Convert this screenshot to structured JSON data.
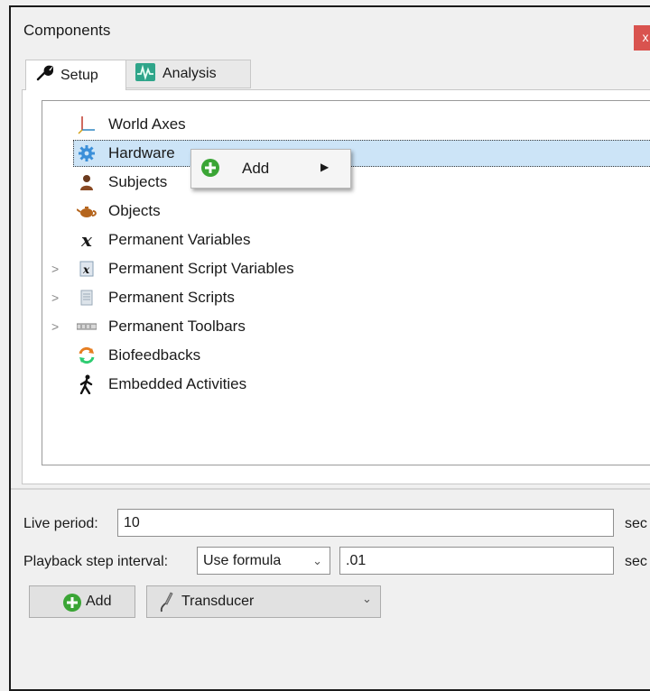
{
  "window": {
    "title": "Components",
    "close_label": "x"
  },
  "tabs": [
    {
      "label": "Setup",
      "icon": "wrench-icon",
      "active": true
    },
    {
      "label": "Analysis",
      "icon": "analysis-wave-icon",
      "active": false
    }
  ],
  "tree": {
    "items": [
      {
        "label": "World Axes",
        "icon": "axes-icon",
        "expandable": false
      },
      {
        "label": "Hardware",
        "icon": "gear-icon",
        "expandable": false,
        "selected": true
      },
      {
        "label": "Subjects",
        "icon": "person-icon",
        "expandable": false
      },
      {
        "label": "Objects",
        "icon": "teapot-icon",
        "expandable": false
      },
      {
        "label": "Permanent Variables",
        "icon": "variable-x-icon",
        "expandable": false
      },
      {
        "label": "Permanent Script Variables",
        "icon": "script-variable-icon",
        "expandable": true
      },
      {
        "label": "Permanent Scripts",
        "icon": "script-icon",
        "expandable": true
      },
      {
        "label": "Permanent Toolbars",
        "icon": "toolbar-icon",
        "expandable": true
      },
      {
        "label": "Biofeedbacks",
        "icon": "biofeedback-icon",
        "expandable": false
      },
      {
        "label": "Embedded Activities",
        "icon": "walking-icon",
        "expandable": false
      }
    ]
  },
  "context_menu": {
    "items": [
      {
        "label": "Add",
        "icon": "add-circle-icon",
        "has_submenu": true
      }
    ]
  },
  "settings": {
    "live_period_label": "Live period:",
    "live_period_value": "10",
    "live_period_unit": "sec",
    "playback_label": "Playback step interval:",
    "playback_mode": "Use formula",
    "playback_value": ".01",
    "playback_unit": "sec"
  },
  "bottom": {
    "add_label": "Add",
    "type_selected": "Transducer"
  },
  "colors": {
    "accent_green": "#3aa535",
    "selection": "#cce4f7",
    "close_red": "#d9534f"
  }
}
